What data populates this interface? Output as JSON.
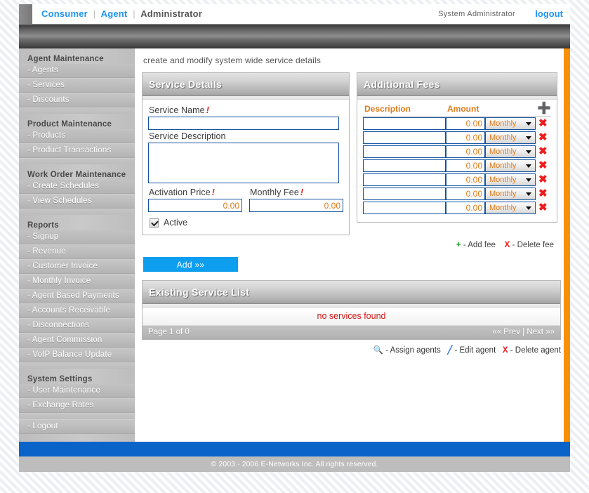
{
  "topnav": {
    "links": [
      {
        "label": "Consumer",
        "style": "blue"
      },
      {
        "label": "Agent",
        "style": "blue"
      },
      {
        "label": "Administrator",
        "style": "dark"
      }
    ],
    "separator": "|",
    "user": "System Administrator",
    "logout": "logout"
  },
  "sidebar": {
    "groups": [
      {
        "heading": "Agent Maintenance",
        "items": [
          "- Agents",
          "- Services",
          "- Discounts"
        ]
      },
      {
        "heading": "Product Maintenance",
        "items": [
          "- Products",
          "- Product Transactions"
        ]
      },
      {
        "heading": "Work Order Maintenance",
        "items": [
          "- Create Schedules",
          "- View Schedules"
        ]
      },
      {
        "heading": "Reports",
        "items": [
          "- Signup",
          "- Revenue",
          "- Customer Invoice",
          "- Monthly Invoice",
          "- Agent Based Payments",
          "- Accounts Receivable",
          "- Disconnections",
          "- Agent Commission",
          "- VoIP Balance Update"
        ]
      },
      {
        "heading": "System Settings",
        "items": [
          "- User Maintenance",
          "- Exchange Rates"
        ]
      },
      {
        "heading": "",
        "items": [
          "- Logout"
        ]
      }
    ]
  },
  "page": {
    "caption": "create and modify system wide service details"
  },
  "service_details": {
    "title": "Service Details",
    "name_label": "Service Name",
    "name_required": "!",
    "name_value": "",
    "desc_label": "Service Description",
    "desc_value": "",
    "activation_label": "Activation Price",
    "activation_required": "!",
    "activation_value": "0.00",
    "monthly_label": "Monthly Fee",
    "monthly_required": "!",
    "monthly_value": "0.00",
    "active_label": "Active",
    "active_checked": true,
    "add_button": "Add »»"
  },
  "additional_fees": {
    "title": "Additional Fees",
    "columns": [
      "Description",
      "Amount"
    ],
    "add_icon": "plus-icon",
    "rows": [
      {
        "description": "",
        "amount": "0.00",
        "period": "Monthly"
      },
      {
        "description": "",
        "amount": "0.00",
        "period": "Monthly"
      },
      {
        "description": "",
        "amount": "0.00",
        "period": "Monthly"
      },
      {
        "description": "",
        "amount": "0.00",
        "period": "Monthly"
      },
      {
        "description": "",
        "amount": "0.00",
        "period": "Monthly"
      },
      {
        "description": "",
        "amount": "0.00",
        "period": "Monthly"
      },
      {
        "description": "",
        "amount": "0.00",
        "period": "Monthly"
      }
    ],
    "legend": {
      "plus_symbol": "+",
      "plus_text": "- Add fee",
      "x_symbol": "X",
      "x_text": "- Delete fee"
    }
  },
  "existing_list": {
    "title": "Existing Service List",
    "empty_message": "no services found",
    "page_status": "Page 1 of 0",
    "prev_label": "«« Prev",
    "pager_separator": "|",
    "next_label": "Next »»",
    "legend": {
      "magnifier_symbol": "🔍",
      "magnifier_text": "- Assign agents",
      "pencil_symbol": "╱",
      "pencil_text": "- Edit agent",
      "x_symbol": "X",
      "x_text": "- Delete agent"
    }
  },
  "footer": {
    "copyright": "© 2003 - 2006 E-Networks Inc. All rights reserved."
  },
  "colors": {
    "accent_blue": "#2094f3",
    "button_blue": "#0e9ef0",
    "bar_blue": "#0a63c9",
    "orange": "#f79009",
    "label_orange": "#e07b1a",
    "required_red": "#e01b1b",
    "delete_red": "#ef1c1c",
    "add_green": "#1f9a1f"
  }
}
